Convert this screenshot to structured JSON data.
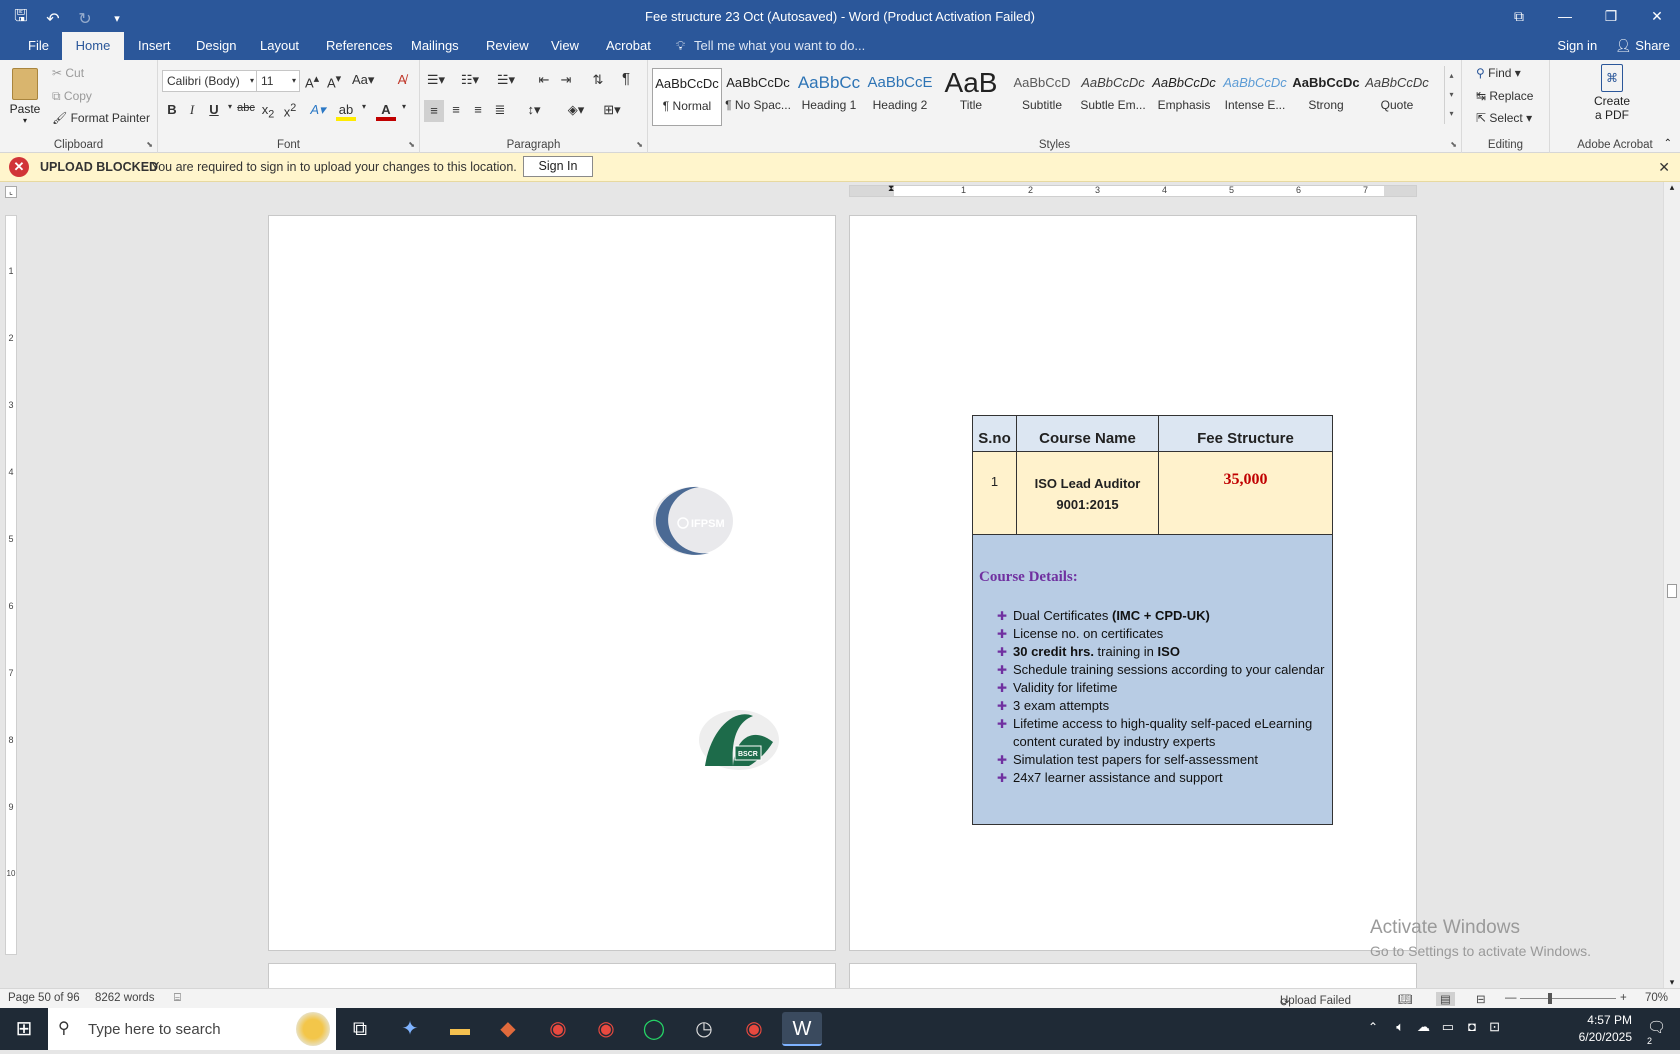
{
  "window": {
    "title": "Fee structure 23 Oct (Autosaved) - Word (Product Activation Failed)",
    "qat": {
      "save_icon": "save-icon",
      "undo_icon": "undo-icon",
      "redo_icon": "redo-icon"
    },
    "controls": {
      "ribbon_display": "⧉",
      "minimize": "—",
      "restore": "❐",
      "close": "✕"
    }
  },
  "tabs": [
    "File",
    "Home",
    "Insert",
    "Design",
    "Layout",
    "References",
    "Mailings",
    "Review",
    "View",
    "Acrobat"
  ],
  "tell_me": "Tell me what you want to do...",
  "sign_in": "Sign in",
  "share": "Share",
  "ribbon": {
    "clipboard": {
      "paste": "Paste",
      "cut": "Cut",
      "copy": "Copy",
      "format_painter": "Format Painter",
      "label": "Clipboard"
    },
    "font": {
      "name": "Calibri (Body)",
      "size": "11",
      "label": "Font"
    },
    "paragraph": {
      "label": "Paragraph"
    },
    "styles": {
      "label": "Styles",
      "items": [
        {
          "preview": "AaBbCcDc",
          "name": "¶ Normal"
        },
        {
          "preview": "AaBbCcDc",
          "name": "¶ No Spac..."
        },
        {
          "preview": "AaBbCc",
          "name": "Heading 1"
        },
        {
          "preview": "AaBbCcE",
          "name": "Heading 2"
        },
        {
          "preview": "AaB",
          "name": "Title"
        },
        {
          "preview": "AaBbCcD",
          "name": "Subtitle"
        },
        {
          "preview": "AaBbCcDc",
          "name": "Subtle Em..."
        },
        {
          "preview": "AaBbCcDc",
          "name": "Emphasis"
        },
        {
          "preview": "AaBbCcDc",
          "name": "Intense E..."
        },
        {
          "preview": "AaBbCcDc",
          "name": "Strong"
        },
        {
          "preview": "AaBbCcDc",
          "name": "Quote"
        }
      ]
    },
    "editing": {
      "find": "Find",
      "replace": "Replace",
      "select": "Select",
      "label": "Editing"
    },
    "acrobat": {
      "create_line1": "Create",
      "create_line2": "a PDF",
      "label": "Adobe Acrobat"
    }
  },
  "message_bar": {
    "title": "UPLOAD BLOCKED",
    "text": "You are required to sign in to upload your changes to this location.",
    "button": "Sign In"
  },
  "ruler": {
    "h_numbers": [
      "1",
      "2",
      "3",
      "4",
      "5",
      "6",
      "7"
    ],
    "v_numbers": [
      "1",
      "2",
      "3",
      "4",
      "5",
      "6",
      "7",
      "8",
      "9",
      "10"
    ]
  },
  "document": {
    "logo1_text": "IFPSM",
    "logo2_text": "BSCR",
    "table": {
      "headers": [
        "S.no",
        "Course Name",
        "Fee Structure"
      ],
      "row": {
        "sno": "1",
        "course_line1": "ISO Lead Auditor",
        "course_line2": "9001:2015",
        "fee": "35,000"
      },
      "details_title": "Course Details:",
      "details": [
        {
          "pre": "Dual Certificates ",
          "bold": "(IMC + CPD-UK)",
          "post": ""
        },
        {
          "pre": "License no. on certificates",
          "bold": "",
          "post": ""
        },
        {
          "pre": "",
          "bold": "30 credit hrs.",
          "post": " training in ",
          "bold2": "ISO"
        },
        {
          "pre": "Schedule training sessions according to your calendar",
          "bold": "",
          "post": ""
        },
        {
          "pre": "Validity for lifetime",
          "bold": "",
          "post": ""
        },
        {
          "pre": "3 exam attempts",
          "bold": "",
          "post": ""
        },
        {
          "pre": "Lifetime access to high-quality self-paced eLearning content curated by industry experts",
          "bold": "",
          "post": ""
        },
        {
          "pre": "Simulation test papers for self-assessment",
          "bold": "",
          "post": ""
        },
        {
          "pre": "24x7 learner assistance and support",
          "bold": "",
          "post": ""
        }
      ]
    }
  },
  "watermark": {
    "line1": "Activate Windows",
    "line2": "Go to Settings to activate Windows."
  },
  "status": {
    "page": "Page 50 of 96",
    "words": "8262 words",
    "upload": "Upload Failed",
    "zoom": "70%"
  },
  "taskbar": {
    "search_placeholder": "Type here to search",
    "time": "4:57 PM",
    "date": "6/20/2025",
    "notifications": "2"
  }
}
